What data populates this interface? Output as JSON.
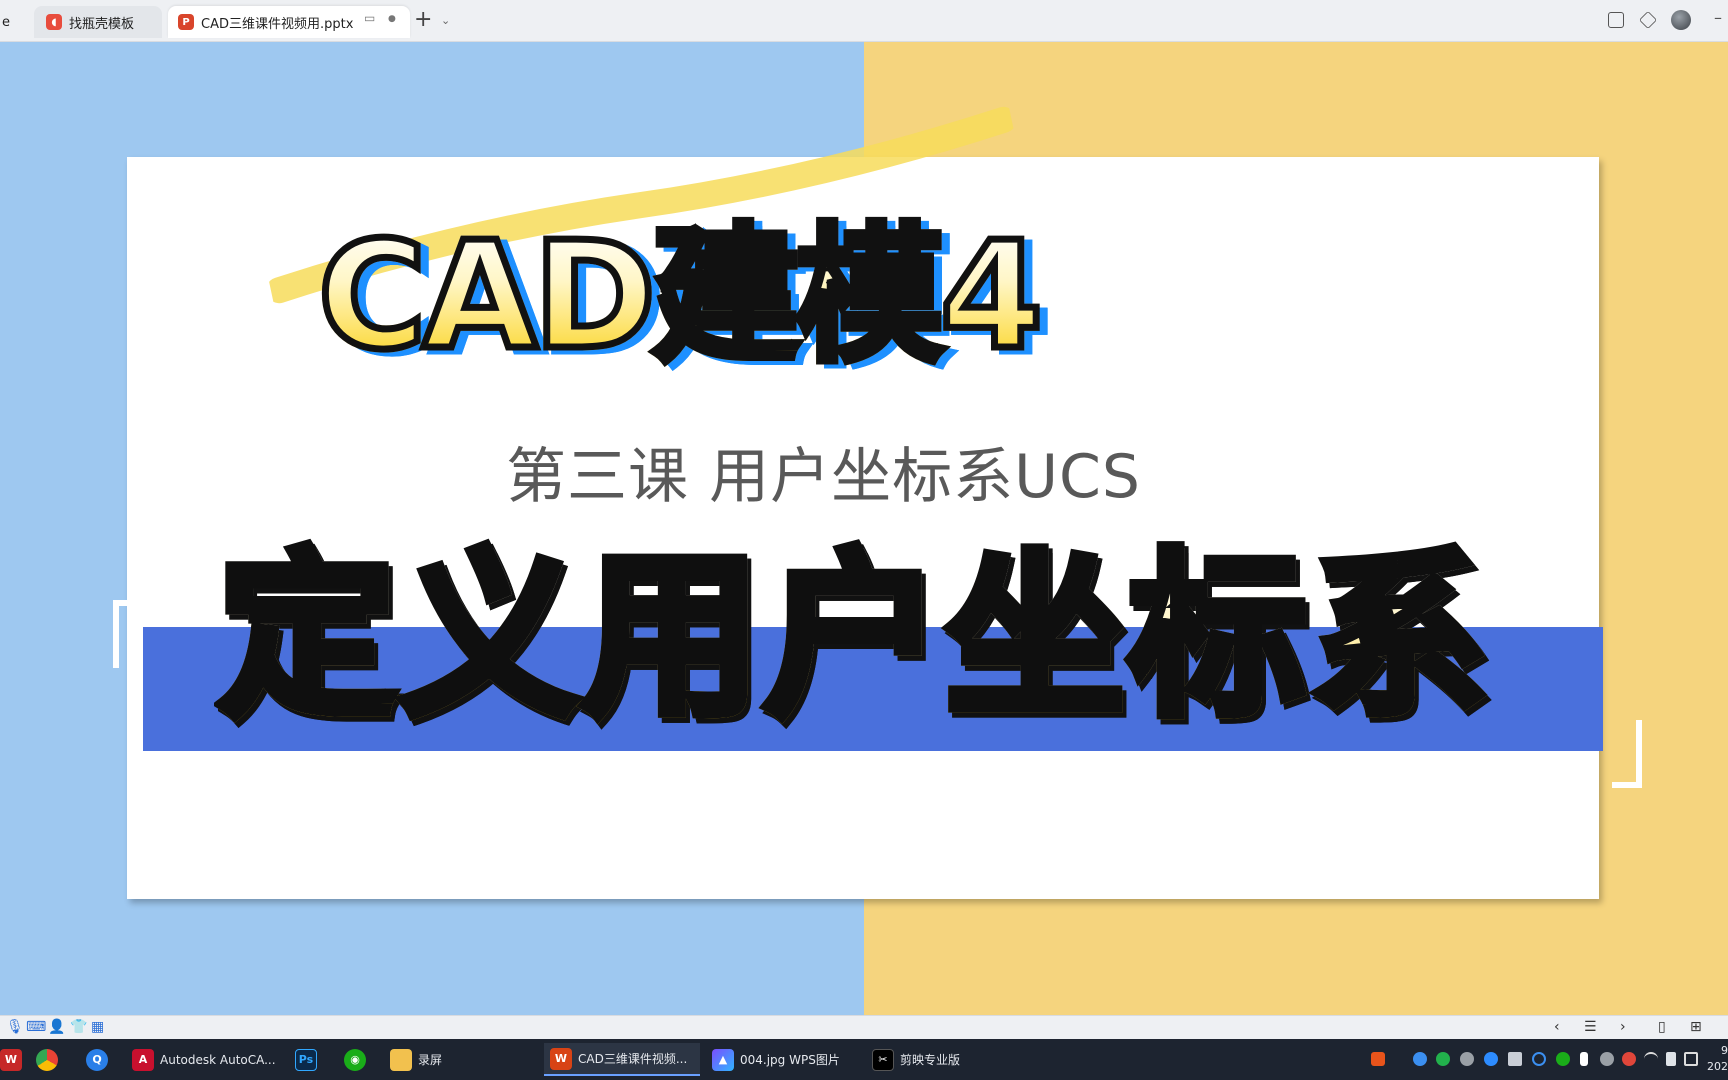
{
  "browser": {
    "tabs": [
      {
        "label": "e"
      },
      {
        "label": "找瓶壳模板",
        "icon": "zhaoke-icon"
      },
      {
        "label": "CAD三维课件视频用.pptx",
        "icon": "ppt-icon"
      }
    ],
    "new_tab_label": "+",
    "new_tab_chevron": "⌄",
    "minimize_label": "–"
  },
  "slide": {
    "title": "CAD建模4",
    "subtitle": "第三课  用户坐标系UCS",
    "heading": "定义用户坐标系",
    "colors": {
      "left_bg": "#9ec8f0",
      "right_bg": "#f5d47e",
      "band": "#4a70dc",
      "title_outline": "#111111",
      "title_fill_bottom": "#fbd21a",
      "title_shadow": "#1e90ff"
    }
  },
  "viewer_bar": {
    "left_icons": [
      "microphone-icon",
      "keyboard-icon",
      "user-icon",
      "shirt-icon",
      "grid-icon"
    ],
    "prev_label": "‹",
    "list_label": "☰",
    "next_label": "›"
  },
  "taskbar": {
    "apps": [
      {
        "label": "",
        "icon": "wps-icon"
      },
      {
        "label": "",
        "icon": "chrome-icon"
      },
      {
        "label": "",
        "icon": "q-browser-icon"
      },
      {
        "label": "Autodesk AutoCA...",
        "icon": "autocad-icon"
      },
      {
        "label": "",
        "icon": "photoshop-icon"
      },
      {
        "label": "",
        "icon": "wechat-icon"
      },
      {
        "label": "录屏",
        "icon": "folder-icon"
      },
      {
        "label": "CAD三维课件视频...",
        "icon": "wps-presentation-icon"
      },
      {
        "label": "004.jpg  WPS图片",
        "icon": "wps-pictures-icon"
      },
      {
        "label": "剪映专业版",
        "icon": "capcut-icon"
      }
    ],
    "clock_time": "9",
    "clock_date": "202"
  }
}
